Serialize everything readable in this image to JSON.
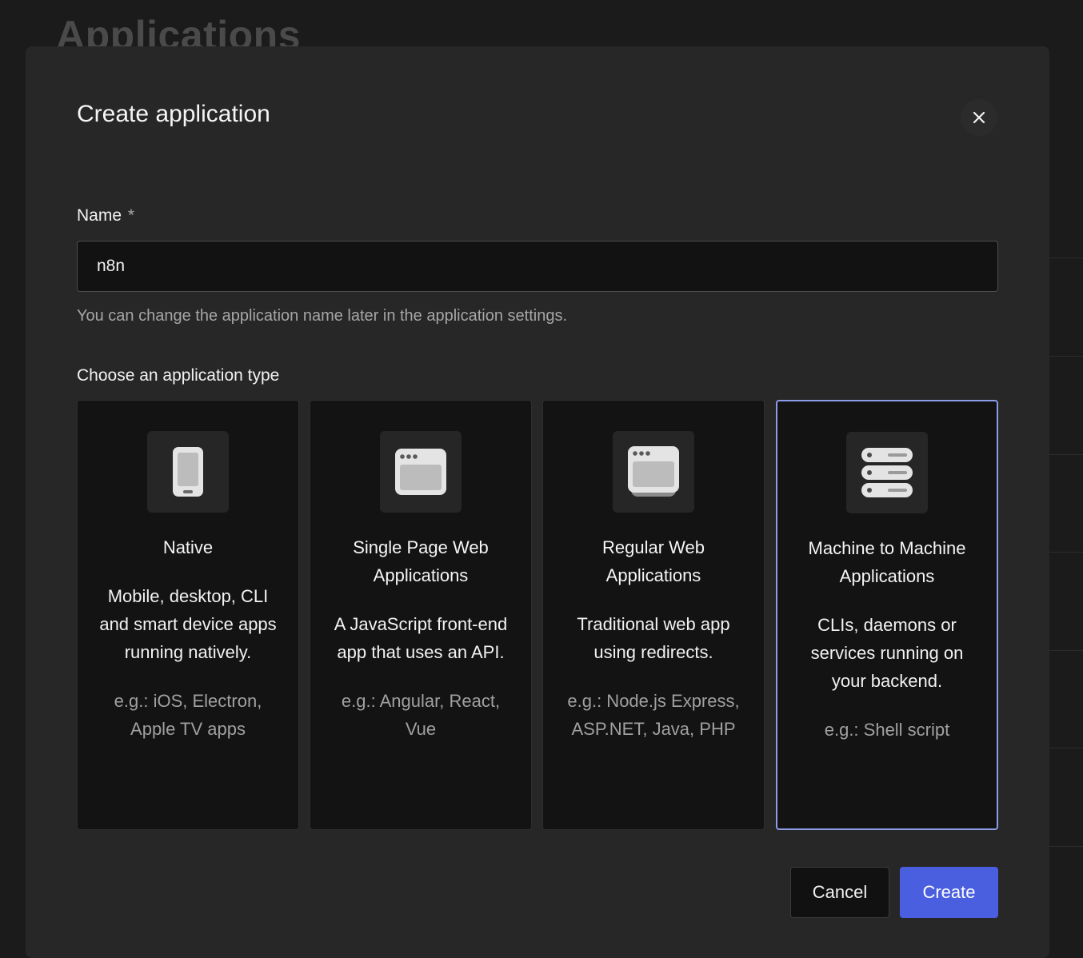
{
  "background": {
    "page_title": "Applications"
  },
  "modal": {
    "title": "Create application",
    "close_icon": "close-icon",
    "name_field": {
      "label": "Name",
      "required_marker": "*",
      "value": "n8n",
      "help": "You can change the application name later in the application settings."
    },
    "type_section_label": "Choose an application type",
    "types": [
      {
        "icon": "phone-icon",
        "title": "Native",
        "description": "Mobile, desktop, CLI and smart device apps running natively.",
        "examples": "e.g.: iOS, Electron, Apple TV apps",
        "selected": false
      },
      {
        "icon": "browser-window-icon",
        "title": "Single Page Web Applications",
        "description": "A JavaScript front-end app that uses an API.",
        "examples": "e.g.: Angular, React, Vue",
        "selected": false
      },
      {
        "icon": "browser-stack-icon",
        "title": "Regular Web Applications",
        "description": "Traditional web app using redirects.",
        "examples": "e.g.: Node.js Express, ASP.NET, Java, PHP",
        "selected": false
      },
      {
        "icon": "server-icon",
        "title": "Machine to Machine Applications",
        "description": "CLIs, daemons or services running on your backend.",
        "examples": "e.g.: Shell script",
        "selected": true
      }
    ],
    "buttons": {
      "cancel": "Cancel",
      "create": "Create"
    }
  },
  "colors": {
    "accent": "#4a5fe0",
    "selected_border": "#8e9be8",
    "modal_bg": "#272727",
    "card_bg": "#131313"
  }
}
